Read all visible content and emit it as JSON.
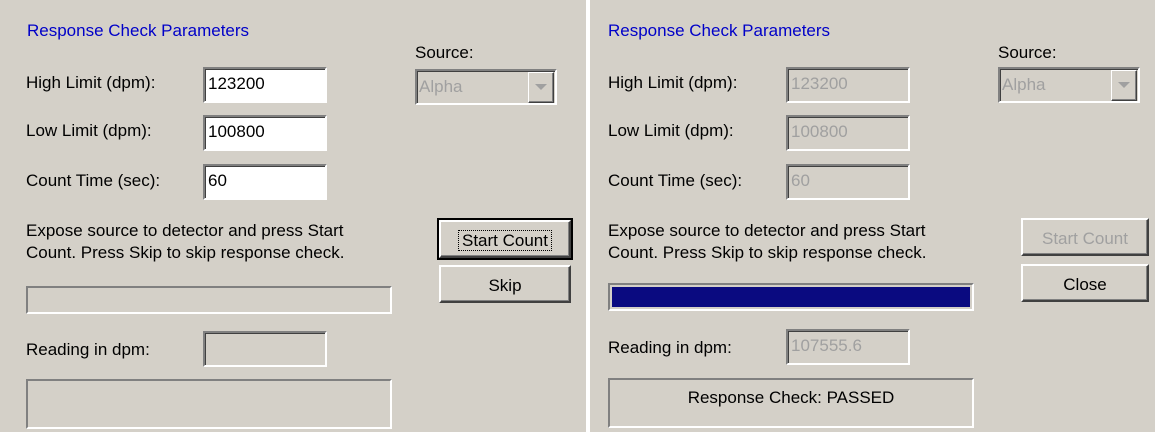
{
  "left": {
    "title": "Response Check Parameters",
    "source_label": "Source:",
    "source_value": "Alpha",
    "high_label": "High Limit (dpm):",
    "high_value": "123200",
    "low_label": "Low Limit (dpm):",
    "low_value": "100800",
    "count_label": "Count Time (sec):",
    "count_value": "60",
    "instructions": "Expose source to detector and press Start\nCount.  Press Skip to skip response check.",
    "start_label": "Start Count",
    "skip_label": "Skip",
    "progress": 0,
    "reading_label": "Reading in dpm:",
    "reading_value": "",
    "status": ""
  },
  "right": {
    "title": "Response Check Parameters",
    "source_label": "Source:",
    "source_value": "Alpha",
    "high_label": "High Limit (dpm):",
    "high_value": "123200",
    "low_label": "Low Limit (dpm):",
    "low_value": "100800",
    "count_label": "Count Time (sec):",
    "count_value": "60",
    "instructions": "Expose source to detector and press Start\nCount.  Press Skip to skip response check.",
    "start_label": "Start Count",
    "close_label": "Close",
    "progress": 1.0,
    "reading_label": "Reading in dpm:",
    "reading_value": "107555.6",
    "status": "Response Check: PASSED"
  },
  "colors": {
    "dialog_bg": "#d4d0c8",
    "title_blue": "#0000c8",
    "progress_fill": "#0a0a80",
    "disabled_text": "#a0a0a0"
  }
}
